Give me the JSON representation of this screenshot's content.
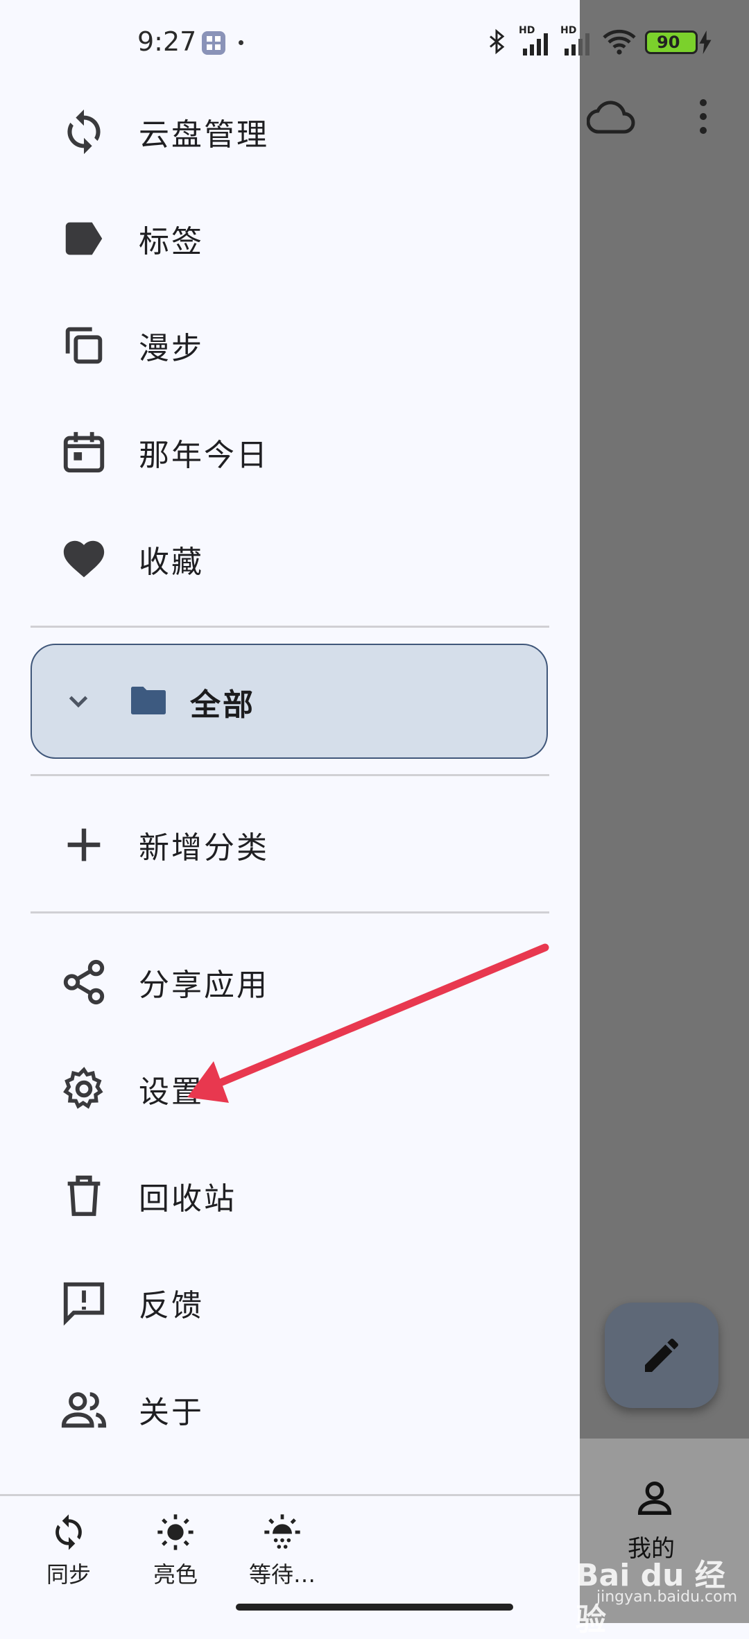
{
  "status_bar": {
    "time": "9:27",
    "battery": "90",
    "net1": "HD",
    "net2": "HD"
  },
  "drawer": {
    "items_top": [
      {
        "label": "云盘管理",
        "icon": "sync-icon"
      },
      {
        "label": "标签",
        "icon": "label-icon"
      },
      {
        "label": "漫步",
        "icon": "copy-icon"
      },
      {
        "label": "那年今日",
        "icon": "calendar-icon"
      },
      {
        "label": "收藏",
        "icon": "heart-icon"
      }
    ],
    "folder": {
      "label": "全部",
      "icon": "folder-icon"
    },
    "add_category": {
      "label": "新增分类",
      "icon": "plus-icon"
    },
    "items_bottom": [
      {
        "label": "分享应用",
        "icon": "share-icon"
      },
      {
        "label": "设置",
        "icon": "gear-icon"
      },
      {
        "label": "回收站",
        "icon": "trash-icon"
      },
      {
        "label": "反馈",
        "icon": "feedback-icon"
      },
      {
        "label": "关于",
        "icon": "people-icon"
      }
    ]
  },
  "bottom_bar": {
    "sync": "同步",
    "light": "亮色",
    "waiting": "等待…"
  },
  "app": {
    "mine_label": "我的"
  },
  "watermark": {
    "brand": "Bai du 经验",
    "url": "jingyan.baidu.com"
  },
  "colors": {
    "accent": "#40577a",
    "folder": "#3d5a80",
    "arrow": "#e8384f"
  }
}
